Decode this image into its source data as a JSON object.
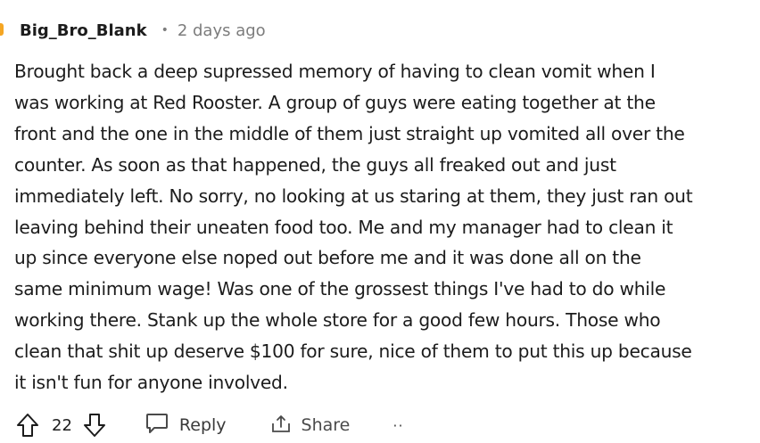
{
  "comment": {
    "author": "Big_Bro_Blank",
    "separator": "•",
    "timestamp": "2 days ago",
    "body_lines": [
      "Brought back a deep supressed memory of having to clean vomit when I",
      "was working at Red Rooster. A group of guys were eating together at the",
      "front and the one in the middle of them just straight up vomited all over the",
      "counter. As soon as that happened, the guys all freaked out and just",
      "immediately left. No sorry, no looking at us staring at them, they just ran out",
      "leaving behind their uneaten food too. Me and my manager had to clean it",
      "up since everyone else noped out before me and it was done all on the",
      "same minimum wage! Was one of the grossest things I've had to do while",
      "working there. Stank up the whole store for a good few hours. Those who",
      "clean that shit up deserve $100 for sure, nice of them to put this up because",
      "it isn't fun for anyone involved."
    ],
    "vote_count": "22",
    "reply_label": "Reply",
    "share_label": "Share",
    "more_label": "··"
  },
  "icons": {
    "upvote": "upvote-arrow-icon",
    "downvote": "downvote-arrow-icon",
    "reply": "speech-bubble-icon",
    "share": "share-icon"
  },
  "colors": {
    "text": "#1c1c1c",
    "muted": "#7c7c7c",
    "thread_accent": "#f5a623"
  }
}
